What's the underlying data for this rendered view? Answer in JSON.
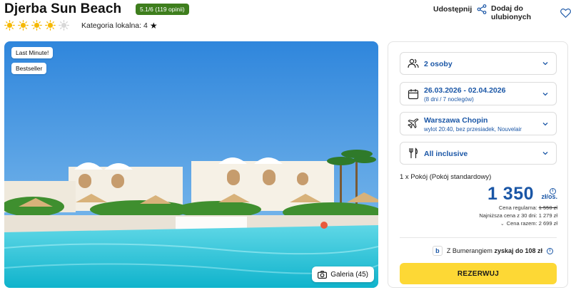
{
  "hotel": {
    "title": "Djerba Sun Beach",
    "rating": "5.1/6 (119 opinii)",
    "suns_filled": 4,
    "suns_total": 5,
    "category_label": "Kategoria lokalna: 4"
  },
  "actions": {
    "share_label": "Udostępnij",
    "favorite_label": "Dodaj do ulubionych"
  },
  "photo": {
    "tags": [
      "Last Minute!",
      "Bestseller"
    ],
    "gallery_label": "Galeria (45)"
  },
  "booking": {
    "persons": "2 osoby",
    "dates": "26.03.2026 - 02.04.2026",
    "dates_sub": "(8 dni / 7 noclegów)",
    "departure": "Warszawa Chopin",
    "departure_sub": "wylot 20:40, bez przesiadek, Nouvelair",
    "board": "All inclusive",
    "room": "1 x Pokój  (Pokój standardowy)",
    "price": "1 350",
    "currency": "zł/os.",
    "regular_label": "Cena regularna:",
    "regular_value": "1 550 zł",
    "lowest_30": "Najniższa cena z 30 dni: 1 279 zł",
    "total": "Cena razem: 2 699 zł",
    "bumerang_prefix": "Z Bumerangiem",
    "bumerang_value": "zyskaj do 108 zł",
    "bumerang_logo": "b",
    "reserve_label": "REZERWUJ"
  },
  "colors": {
    "accent_blue": "#1a56a6",
    "rating_green": "#3e7e1d",
    "sun_yellow": "#f5b800",
    "reserve_yellow": "#fdd835"
  }
}
